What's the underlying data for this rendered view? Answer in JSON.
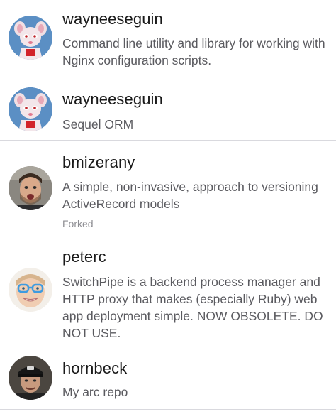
{
  "repos": [
    {
      "owner": "wayneeseguin",
      "description": "Command line utility and library for working with Nginx configuration scripts.",
      "avatar_icon": "pinky-and-brain-avatar-icon"
    },
    {
      "owner": "wayneeseguin",
      "description": "Sequel ORM",
      "avatar_icon": "pinky-and-brain-avatar-icon"
    },
    {
      "owner": "bmizerany",
      "description": "A simple, non-invasive, approach to versioning ActiveRecord models",
      "forked_label": "Forked",
      "avatar_icon": "user-photo-avatar-icon"
    },
    {
      "owner": "peterc",
      "description": "SwitchPipe is a backend process manager and HTTP proxy that makes (especially Ruby) web app deployment simple. NOW OBSOLETE. DO NOT USE.",
      "avatar_icon": "user-photo-avatar-icon"
    },
    {
      "owner": "hornbeck",
      "description": "My arc repo",
      "avatar_icon": "user-photo-avatar-icon"
    }
  ],
  "colors": {
    "name_text": "#1a1a1a",
    "description_text": "#5a5a5f",
    "forked_text": "#8e8e93",
    "separator": "#d9d9de",
    "background": "#ffffff"
  }
}
